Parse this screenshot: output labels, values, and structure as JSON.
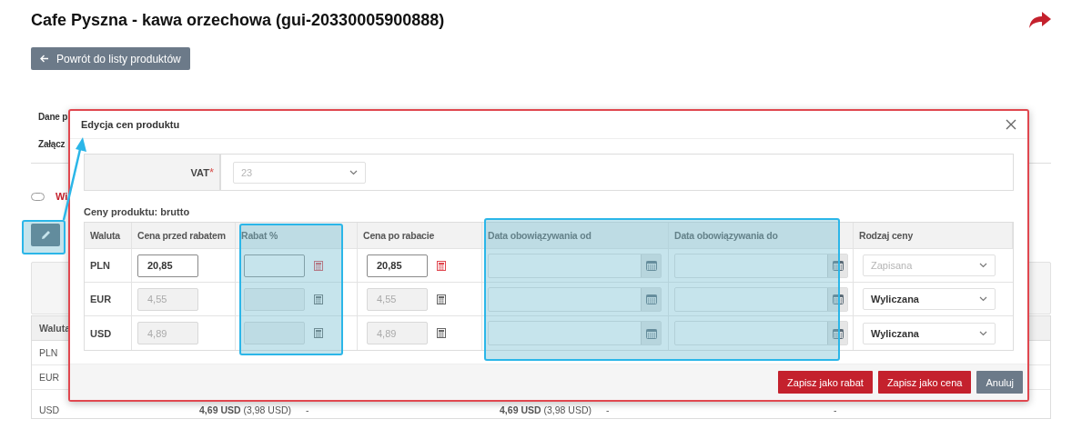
{
  "page": {
    "title": "Cafe Pyszna - kawa orzechowa (gui-20330005900888)",
    "back_button": "Powrót do listy produktów",
    "tabs": [
      "Dane p",
      "Załącz"
    ],
    "toggle": {
      "on": false
    },
    "toggle_label": "Wi"
  },
  "background_table": {
    "header": "Waluta",
    "rows": [
      {
        "currency": "PLN",
        "cells": []
      },
      {
        "currency": "EUR",
        "cells": []
      },
      {
        "currency": "USD",
        "cells": [
          "**4,69 USD** (3,98 USD)",
          "-",
          "**4,69 USD** (3,98 USD)",
          "-",
          "-"
        ]
      }
    ]
  },
  "dialog": {
    "title": "Edycja cen produktu",
    "vat": {
      "label": "VAT",
      "required_mark": "*",
      "value": "23",
      "disabled": true
    },
    "section_title": "Ceny produktu: brutto",
    "columns": [
      "Waluta",
      "Cena przed rabatem",
      "Rabat %",
      "Cena po rabacie",
      "Data obowiązywania od",
      "Data obowiązywania do",
      "Rodzaj ceny"
    ],
    "rows": [
      {
        "currency": "PLN",
        "price_before": {
          "value": "20,85",
          "disabled": false
        },
        "discount": {
          "disabled": false
        },
        "calculator_active": true,
        "price_after": {
          "value": "20,85",
          "disabled": false
        },
        "price_type": {
          "value": "Zapisana",
          "disabled": true
        }
      },
      {
        "currency": "EUR",
        "price_before": {
          "value": "4,55",
          "disabled": true
        },
        "discount": {
          "disabled": true
        },
        "calculator_active": false,
        "price_after": {
          "value": "4,55",
          "disabled": true
        },
        "price_type": {
          "value": "Wyliczana",
          "disabled": false
        }
      },
      {
        "currency": "USD",
        "price_before": {
          "value": "4,89",
          "disabled": true
        },
        "discount": {
          "disabled": true
        },
        "calculator_active": false,
        "price_after": {
          "value": "4,89",
          "disabled": true
        },
        "price_type": {
          "value": "Wyliczana",
          "disabled": false
        }
      }
    ],
    "buttons": [
      {
        "label": "Zapisz jako rabat",
        "kind": "primary"
      },
      {
        "label": "Zapisz jako cena",
        "kind": "primary"
      },
      {
        "label": "Anuluj",
        "kind": "secondary"
      }
    ]
  }
}
